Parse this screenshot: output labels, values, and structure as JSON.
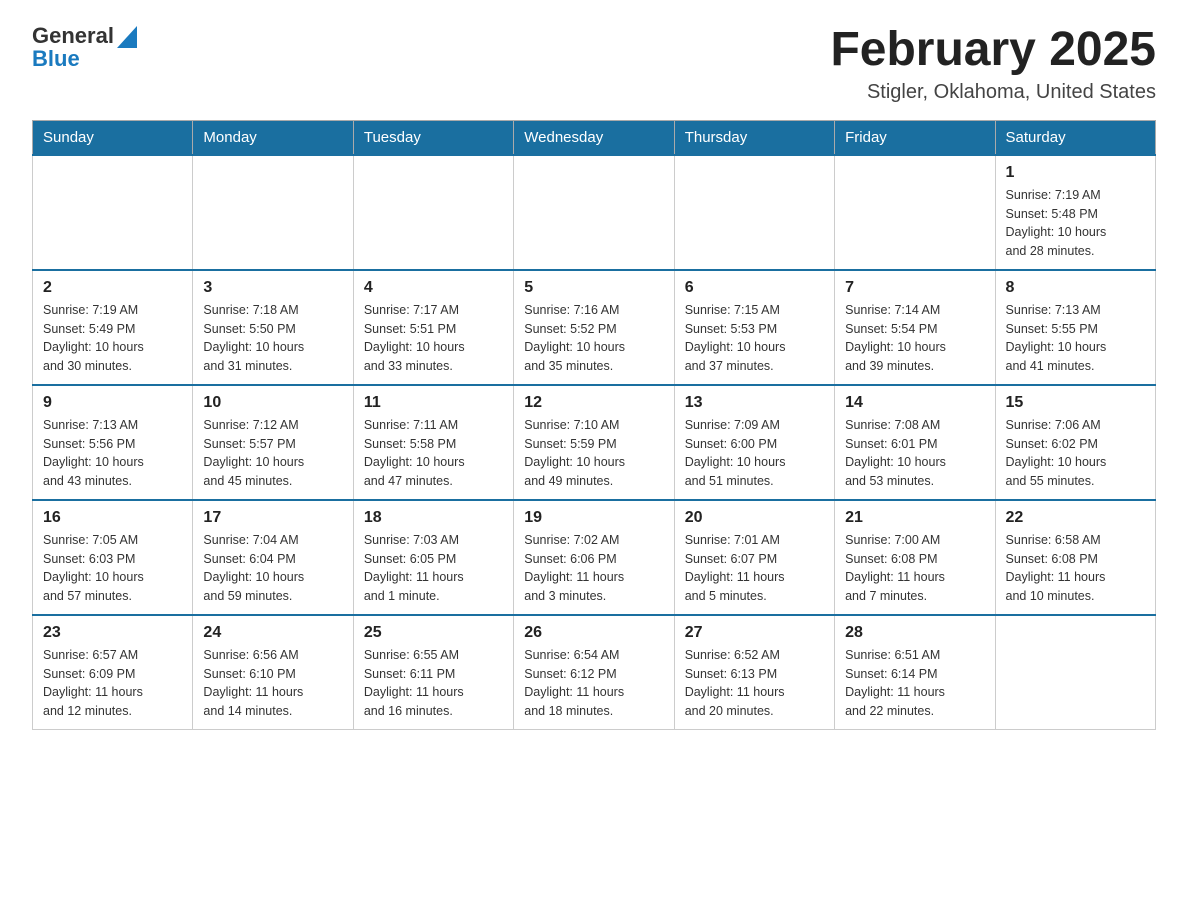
{
  "header": {
    "logo_general": "General",
    "logo_blue": "Blue",
    "month_title": "February 2025",
    "location": "Stigler, Oklahoma, United States"
  },
  "days_of_week": [
    "Sunday",
    "Monday",
    "Tuesday",
    "Wednesday",
    "Thursday",
    "Friday",
    "Saturday"
  ],
  "weeks": [
    {
      "days": [
        {
          "number": "",
          "info": ""
        },
        {
          "number": "",
          "info": ""
        },
        {
          "number": "",
          "info": ""
        },
        {
          "number": "",
          "info": ""
        },
        {
          "number": "",
          "info": ""
        },
        {
          "number": "",
          "info": ""
        },
        {
          "number": "1",
          "info": "Sunrise: 7:19 AM\nSunset: 5:48 PM\nDaylight: 10 hours\nand 28 minutes."
        }
      ]
    },
    {
      "days": [
        {
          "number": "2",
          "info": "Sunrise: 7:19 AM\nSunset: 5:49 PM\nDaylight: 10 hours\nand 30 minutes."
        },
        {
          "number": "3",
          "info": "Sunrise: 7:18 AM\nSunset: 5:50 PM\nDaylight: 10 hours\nand 31 minutes."
        },
        {
          "number": "4",
          "info": "Sunrise: 7:17 AM\nSunset: 5:51 PM\nDaylight: 10 hours\nand 33 minutes."
        },
        {
          "number": "5",
          "info": "Sunrise: 7:16 AM\nSunset: 5:52 PM\nDaylight: 10 hours\nand 35 minutes."
        },
        {
          "number": "6",
          "info": "Sunrise: 7:15 AM\nSunset: 5:53 PM\nDaylight: 10 hours\nand 37 minutes."
        },
        {
          "number": "7",
          "info": "Sunrise: 7:14 AM\nSunset: 5:54 PM\nDaylight: 10 hours\nand 39 minutes."
        },
        {
          "number": "8",
          "info": "Sunrise: 7:13 AM\nSunset: 5:55 PM\nDaylight: 10 hours\nand 41 minutes."
        }
      ]
    },
    {
      "days": [
        {
          "number": "9",
          "info": "Sunrise: 7:13 AM\nSunset: 5:56 PM\nDaylight: 10 hours\nand 43 minutes."
        },
        {
          "number": "10",
          "info": "Sunrise: 7:12 AM\nSunset: 5:57 PM\nDaylight: 10 hours\nand 45 minutes."
        },
        {
          "number": "11",
          "info": "Sunrise: 7:11 AM\nSunset: 5:58 PM\nDaylight: 10 hours\nand 47 minutes."
        },
        {
          "number": "12",
          "info": "Sunrise: 7:10 AM\nSunset: 5:59 PM\nDaylight: 10 hours\nand 49 minutes."
        },
        {
          "number": "13",
          "info": "Sunrise: 7:09 AM\nSunset: 6:00 PM\nDaylight: 10 hours\nand 51 minutes."
        },
        {
          "number": "14",
          "info": "Sunrise: 7:08 AM\nSunset: 6:01 PM\nDaylight: 10 hours\nand 53 minutes."
        },
        {
          "number": "15",
          "info": "Sunrise: 7:06 AM\nSunset: 6:02 PM\nDaylight: 10 hours\nand 55 minutes."
        }
      ]
    },
    {
      "days": [
        {
          "number": "16",
          "info": "Sunrise: 7:05 AM\nSunset: 6:03 PM\nDaylight: 10 hours\nand 57 minutes."
        },
        {
          "number": "17",
          "info": "Sunrise: 7:04 AM\nSunset: 6:04 PM\nDaylight: 10 hours\nand 59 minutes."
        },
        {
          "number": "18",
          "info": "Sunrise: 7:03 AM\nSunset: 6:05 PM\nDaylight: 11 hours\nand 1 minute."
        },
        {
          "number": "19",
          "info": "Sunrise: 7:02 AM\nSunset: 6:06 PM\nDaylight: 11 hours\nand 3 minutes."
        },
        {
          "number": "20",
          "info": "Sunrise: 7:01 AM\nSunset: 6:07 PM\nDaylight: 11 hours\nand 5 minutes."
        },
        {
          "number": "21",
          "info": "Sunrise: 7:00 AM\nSunset: 6:08 PM\nDaylight: 11 hours\nand 7 minutes."
        },
        {
          "number": "22",
          "info": "Sunrise: 6:58 AM\nSunset: 6:08 PM\nDaylight: 11 hours\nand 10 minutes."
        }
      ]
    },
    {
      "days": [
        {
          "number": "23",
          "info": "Sunrise: 6:57 AM\nSunset: 6:09 PM\nDaylight: 11 hours\nand 12 minutes."
        },
        {
          "number": "24",
          "info": "Sunrise: 6:56 AM\nSunset: 6:10 PM\nDaylight: 11 hours\nand 14 minutes."
        },
        {
          "number": "25",
          "info": "Sunrise: 6:55 AM\nSunset: 6:11 PM\nDaylight: 11 hours\nand 16 minutes."
        },
        {
          "number": "26",
          "info": "Sunrise: 6:54 AM\nSunset: 6:12 PM\nDaylight: 11 hours\nand 18 minutes."
        },
        {
          "number": "27",
          "info": "Sunrise: 6:52 AM\nSunset: 6:13 PM\nDaylight: 11 hours\nand 20 minutes."
        },
        {
          "number": "28",
          "info": "Sunrise: 6:51 AM\nSunset: 6:14 PM\nDaylight: 11 hours\nand 22 minutes."
        },
        {
          "number": "",
          "info": ""
        }
      ]
    }
  ]
}
